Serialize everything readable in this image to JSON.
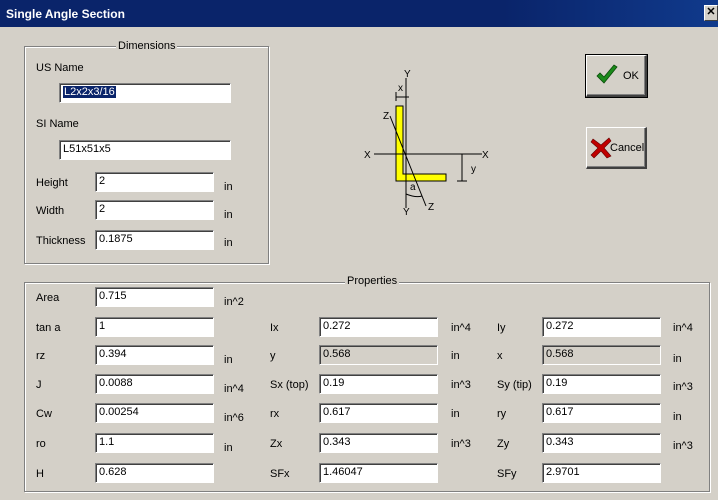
{
  "window": {
    "title": "Single Angle Section",
    "close_glyph": "✕"
  },
  "dimensions": {
    "legend": "Dimensions",
    "us_name_label": "US Name",
    "us_name_value": "L2x2x3/16",
    "si_name_label": "SI Name",
    "si_name_value": "L51x51x5",
    "height_label": "Height",
    "height_value": "2",
    "height_unit": "in",
    "width_label": "Width",
    "width_value": "2",
    "width_unit": "in",
    "thickness_label": "Thickness",
    "thickness_value": "0.1875",
    "thickness_unit": "in"
  },
  "diagram": {
    "x_left": "X",
    "x_right": "X",
    "y_top": "Y",
    "y_bottom": "Y",
    "x_small": "x",
    "y_small": "y",
    "z_top": "Z",
    "z_bottom": "Z",
    "a_label": "a",
    "shape_color": "#ffff00"
  },
  "buttons": {
    "ok_label": "OK",
    "cancel_label": "Cancel",
    "ok_icon": "checkmark-icon",
    "cancel_icon": "x-icon",
    "check_color": "#1a8a1a",
    "x_color": "#c00000"
  },
  "properties": {
    "legend": "Properties",
    "col1": [
      {
        "label": "Area",
        "value": "0.715",
        "unit": "in^2"
      },
      {
        "label": "tan a",
        "value": "1",
        "unit": ""
      },
      {
        "label": "rz",
        "value": "0.394",
        "unit": "in"
      },
      {
        "label": "J",
        "value": "0.0088",
        "unit": "in^4"
      },
      {
        "label": "Cw",
        "value": "0.00254",
        "unit": "in^6"
      },
      {
        "label": "ro",
        "value": "1.1",
        "unit": "in"
      },
      {
        "label": "H",
        "value": "0.628",
        "unit": ""
      }
    ],
    "col2": [
      {
        "label": "Ix",
        "value": "0.272",
        "unit": "in^4"
      },
      {
        "label": "y",
        "value": "0.568",
        "unit": "in"
      },
      {
        "label": "Sx (top)",
        "value": "0.19",
        "unit": "in^3"
      },
      {
        "label": "rx",
        "value": "0.617",
        "unit": "in"
      },
      {
        "label": "Zx",
        "value": "0.343",
        "unit": "in^3"
      },
      {
        "label": "SFx",
        "value": "1.46047",
        "unit": ""
      }
    ],
    "col3": [
      {
        "label": "Iy",
        "value": "0.272",
        "unit": "in^4"
      },
      {
        "label": "x",
        "value": "0.568",
        "unit": "in"
      },
      {
        "label": "Sy (tip)",
        "value": "0.19",
        "unit": "in^3"
      },
      {
        "label": "ry",
        "value": "0.617",
        "unit": "in"
      },
      {
        "label": "Zy",
        "value": "0.343",
        "unit": "in^3"
      },
      {
        "label": "SFy",
        "value": "2.9701",
        "unit": ""
      }
    ]
  }
}
